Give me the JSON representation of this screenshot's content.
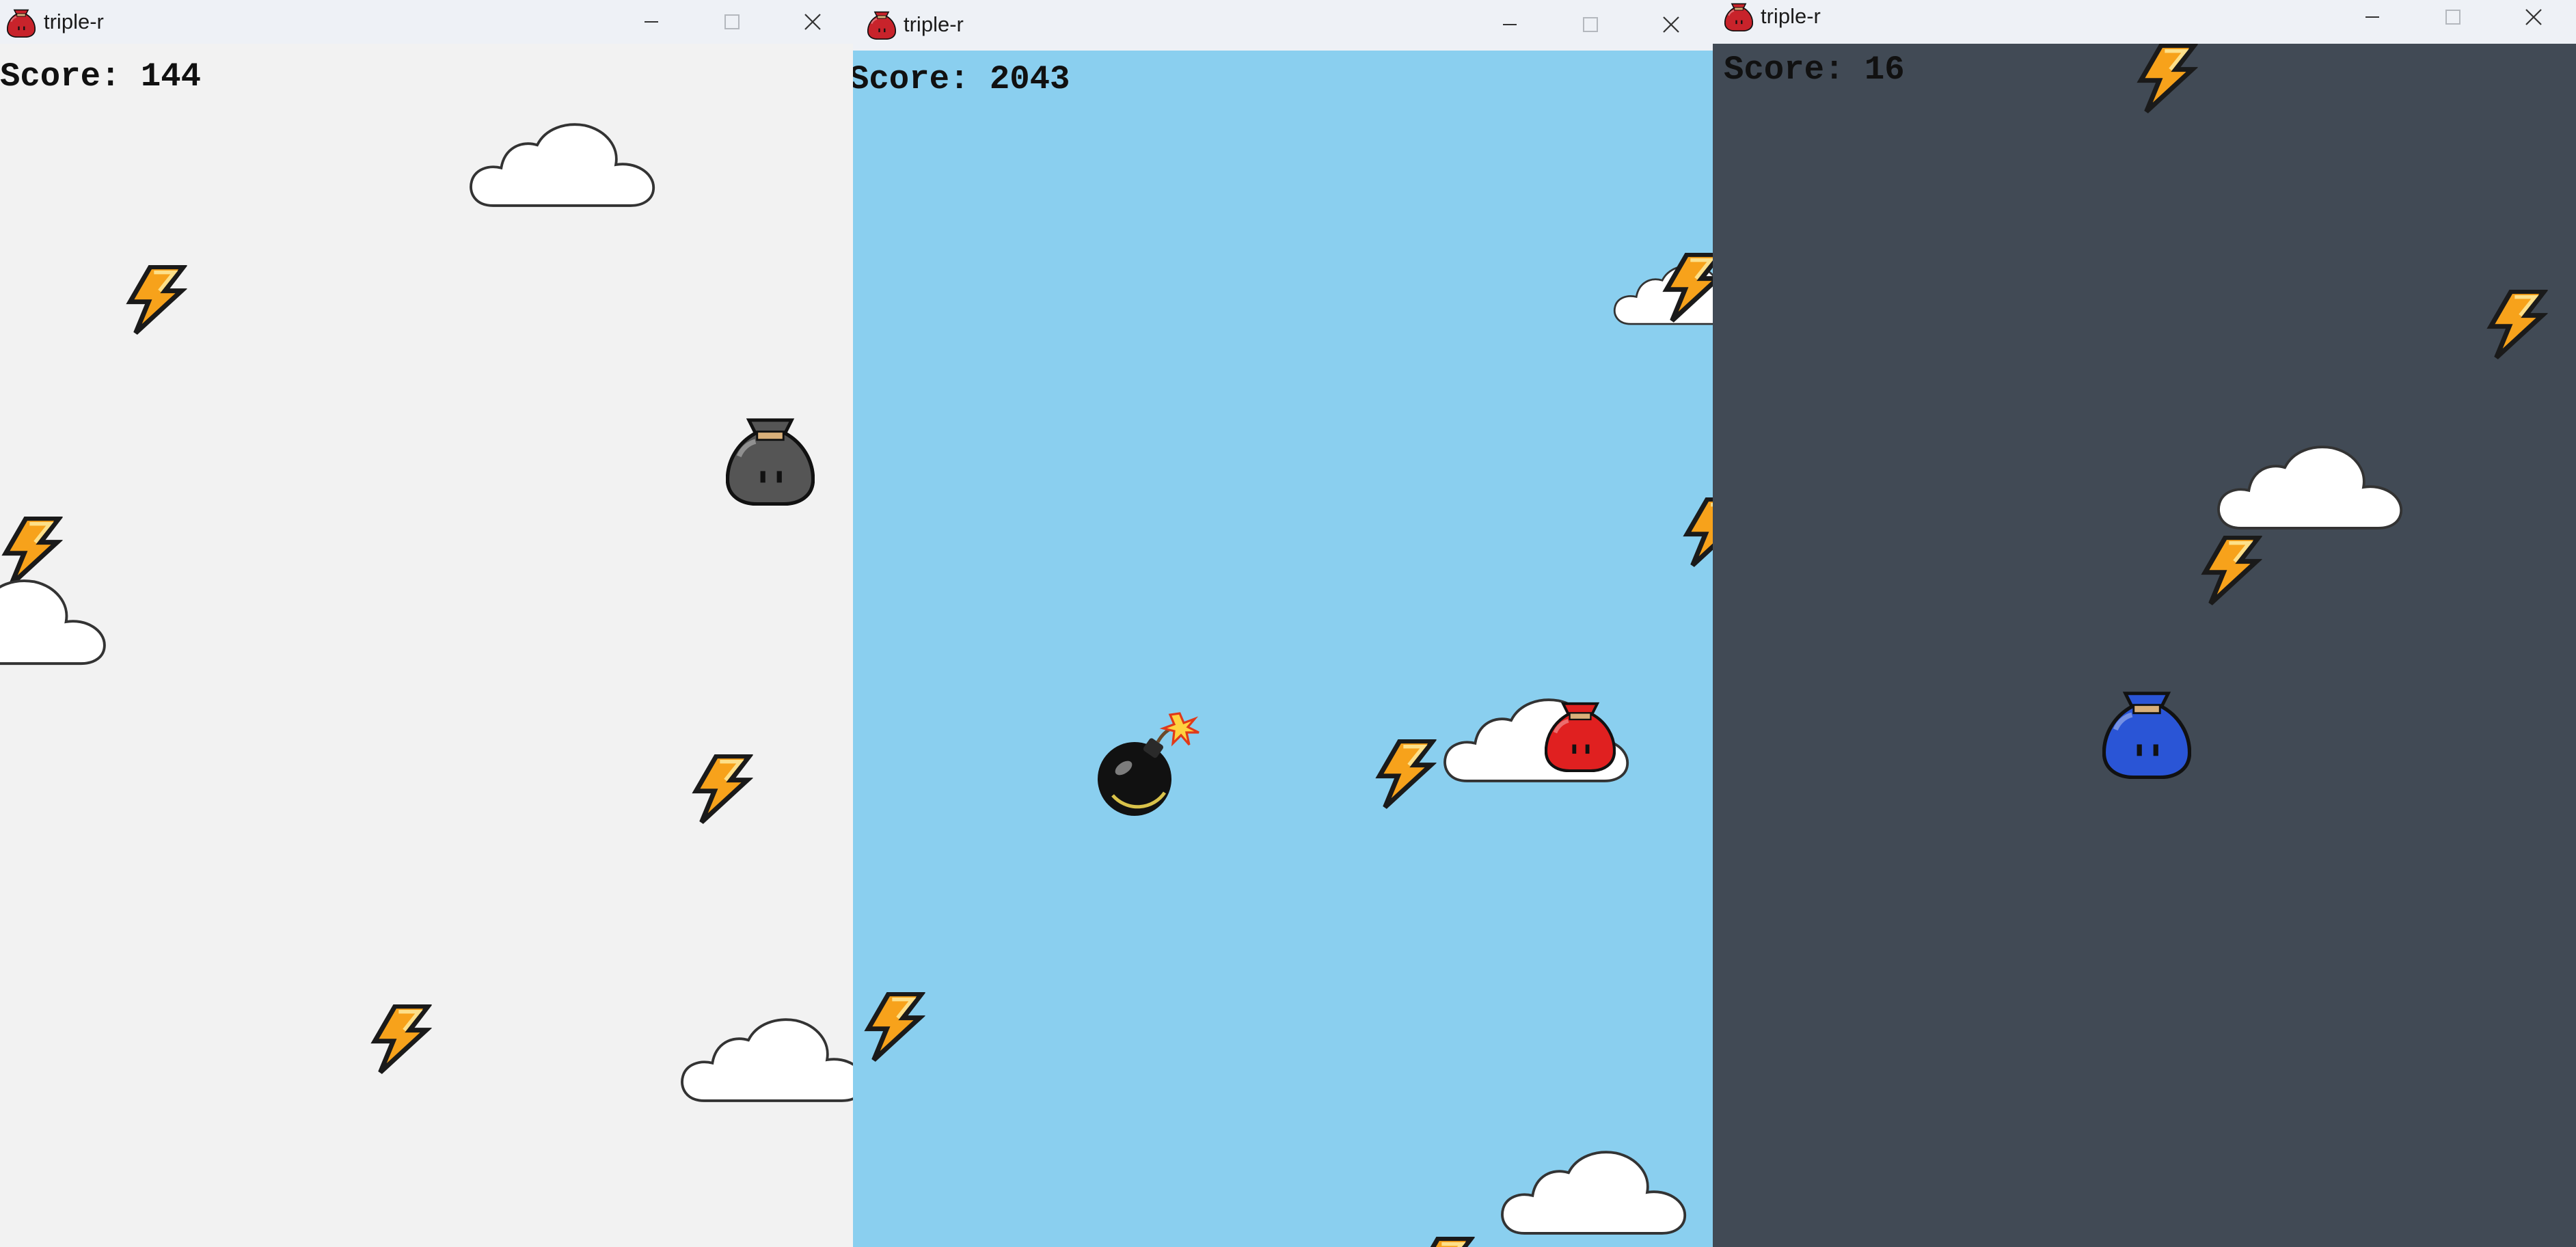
{
  "windows": [
    {
      "title": "triple-r",
      "score_label": "Score: 144",
      "background_color": "#f2f2f2",
      "score_color": "#111111",
      "player": {
        "sprite": "moneybag-grey-icon",
        "color": "#555555"
      },
      "objects": [
        "lightning-bolt-icon",
        "lightning-bolt-icon",
        "lightning-bolt-icon",
        "lightning-bolt-icon",
        "cloud",
        "cloud",
        "cloud"
      ]
    },
    {
      "title": "triple-r",
      "score_label": "Score: 2043",
      "background_color": "#8acfef",
      "score_color": "#111111",
      "player": {
        "sprite": "moneybag-red-icon",
        "color": "#e02020"
      },
      "objects": [
        "bomb-icon",
        "lightning-bolt-icon",
        "lightning-bolt-icon",
        "lightning-bolt-icon",
        "lightning-bolt-icon",
        "lightning-bolt-icon",
        "cloud",
        "cloud",
        "cloud"
      ]
    },
    {
      "title": "triple-r",
      "score_label": "Score: 16",
      "background_color": "#414a55",
      "score_color": "#111111",
      "player": {
        "sprite": "moneybag-blue-icon",
        "color": "#2a55d6"
      },
      "objects": [
        "lightning-bolt-icon",
        "lightning-bolt-icon",
        "lightning-bolt-icon",
        "cloud"
      ]
    }
  ],
  "controls": [
    "minimize-icon",
    "maximize-icon",
    "close-icon"
  ],
  "colors": {
    "titlebar": "#eef1f6",
    "lightning": "#f7a21b",
    "cloud_fill": "#ffffff",
    "cloud_stroke": "#333333"
  }
}
